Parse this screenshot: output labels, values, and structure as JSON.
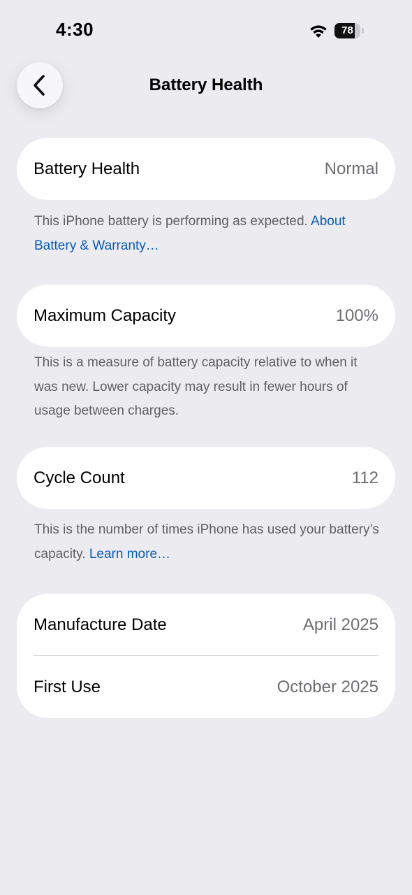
{
  "status_bar": {
    "time": "4:30",
    "battery_level": "78",
    "battery_fraction": 0.78
  },
  "nav": {
    "title": "Battery Health",
    "back_icon": "chevron-left-icon"
  },
  "battery_health": {
    "label": "Battery Health",
    "value": "Normal",
    "footnote": "This iPhone battery is performing as expected. ",
    "link": "About Battery & Warranty…"
  },
  "max_capacity": {
    "label": "Maximum Capacity",
    "value": "100%",
    "footnote": "This is a measure of battery capacity relative to when it was new. Lower capacity may result in fewer hours of usage between charges."
  },
  "cycle_count": {
    "label": "Cycle Count",
    "value": "112",
    "footnote": "This is the number of times iPhone has used your battery’s capacity. ",
    "link": "Learn more…"
  },
  "dates": {
    "manufacture_label": "Manufacture Date",
    "manufacture_value": "April 2025",
    "first_use_label": "First Use",
    "first_use_value": "October 2025"
  },
  "colors": {
    "background": "#ebebf0",
    "card": "#ffffff",
    "link": "#0a5bb5",
    "secondary_text": "#6d6d72"
  }
}
